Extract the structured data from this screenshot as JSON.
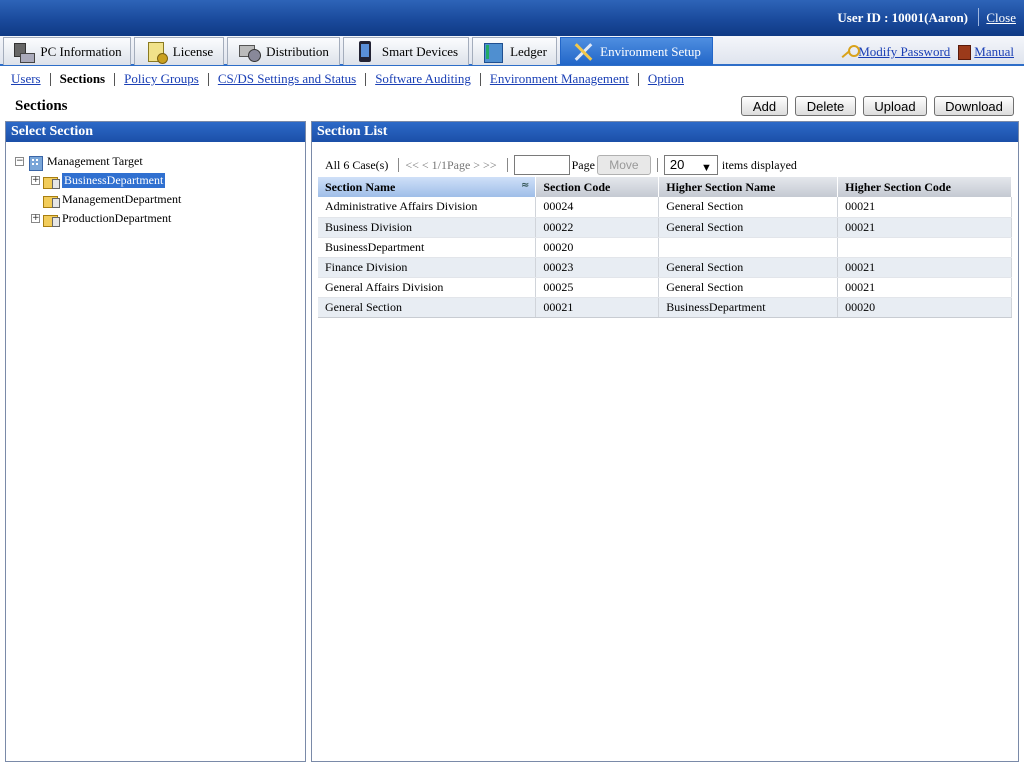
{
  "header": {
    "user_id": "User ID : 10001(Aaron)",
    "close": "Close"
  },
  "tabs": [
    {
      "label": "PC Information",
      "icon": "pc-icon"
    },
    {
      "label": "License",
      "icon": "license-icon"
    },
    {
      "label": "Distribution",
      "icon": "distribution-icon"
    },
    {
      "label": "Smart Devices",
      "icon": "smart-device-icon"
    },
    {
      "label": "Ledger",
      "icon": "ledger-icon"
    },
    {
      "label": "Environment Setup",
      "icon": "tools-icon",
      "active": true
    }
  ],
  "top_links": {
    "modify_password": "Modify Password",
    "manual": "Manual"
  },
  "subnav": {
    "items": [
      "Users",
      "Sections",
      "Policy Groups",
      "CS/DS Settings and Status",
      "Software Auditing",
      "Environment Management",
      "Option"
    ],
    "current": "Sections"
  },
  "page": {
    "title": "Sections"
  },
  "actions": {
    "add": "Add",
    "delete": "Delete",
    "upload": "Upload",
    "download": "Download"
  },
  "left_panel": {
    "title": "Select Section",
    "tree": {
      "root": "Management Target",
      "children": [
        {
          "label": "BusinessDepartment",
          "expander": "+",
          "selected": true
        },
        {
          "label": "ManagementDepartment",
          "expander": ""
        },
        {
          "label": "ProductionDepartment",
          "expander": "+"
        }
      ]
    }
  },
  "right_panel": {
    "title": "Section List",
    "pager": {
      "total": "All 6 Case(s)",
      "nav": "<< < 1/1Page > >>",
      "page_label": "Page",
      "page_value": "",
      "move": "Move",
      "per_page": "20",
      "items_displayed": "items displayed"
    },
    "columns": [
      "Section Name",
      "Section Code",
      "Higher Section Name",
      "Higher Section Code"
    ],
    "rows": [
      [
        "Administrative Affairs Division",
        "00024",
        "General Section",
        "00021"
      ],
      [
        "Business Division",
        "00022",
        "General Section",
        "00021"
      ],
      [
        "BusinessDepartment",
        "00020",
        "",
        ""
      ],
      [
        "Finance Division",
        "00023",
        "General Section",
        "00021"
      ],
      [
        "General Affairs Division",
        "00025",
        "General Section",
        "00021"
      ],
      [
        "General Section",
        "00021",
        "BusinessDepartment",
        "00020"
      ]
    ]
  }
}
